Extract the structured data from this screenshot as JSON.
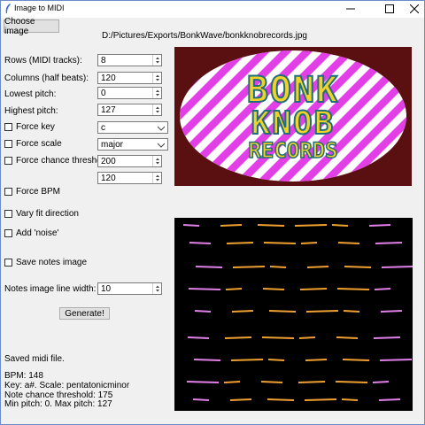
{
  "window": {
    "title": "Image to MIDI",
    "icon": "feather-icon"
  },
  "toolbar": {
    "choose_label": "Choose image",
    "path": "D:/Pictures/Exports/BonkWave/bonkknobrecords.jpg"
  },
  "fields": {
    "rows": {
      "label": "Rows (MIDI tracks):",
      "value": "8"
    },
    "columns": {
      "label": "Columns (half beats):",
      "value": "120"
    },
    "lowest": {
      "label": "Lowest pitch:",
      "value": "0"
    },
    "highest": {
      "label": "Highest pitch:",
      "value": "127"
    },
    "force_key": {
      "label": "Force key",
      "value": "c",
      "checked": false
    },
    "force_scale": {
      "label": "Force scale",
      "value": "major",
      "checked": false
    },
    "force_chance": {
      "label": "Force chance threshold",
      "value": "200",
      "value2": "120",
      "checked": false
    },
    "force_bpm": {
      "label": "Force BPM",
      "checked": false
    },
    "vary_fit": {
      "label": "Vary fit direction",
      "checked": false
    },
    "add_noise": {
      "label": "Add 'noise'",
      "checked": false
    },
    "save_notes": {
      "label": "Save notes image",
      "checked": false
    },
    "line_width": {
      "label": "Notes image line width:",
      "value": "10"
    }
  },
  "generate_label": "Generate!",
  "logo": {
    "line1": "BONK",
    "line2": "KNOB",
    "line3": "RECORDS"
  },
  "status": {
    "saved": "Saved midi file.",
    "bpm": "BPM: 148",
    "key": "Key: a#.   Scale: pentatonicminor",
    "chance": "Note chance threshold: 175",
    "pitch": "Min pitch: 0.   Max pitch: 127"
  },
  "colors": {
    "accent_magenta": "#e23fe6",
    "logo_red": "#5a1010",
    "logo_yellow": "#f2d22a",
    "logo_teal": "#1f6f7a",
    "note_pink": "#e080e8",
    "note_orange": "#f0a030"
  }
}
